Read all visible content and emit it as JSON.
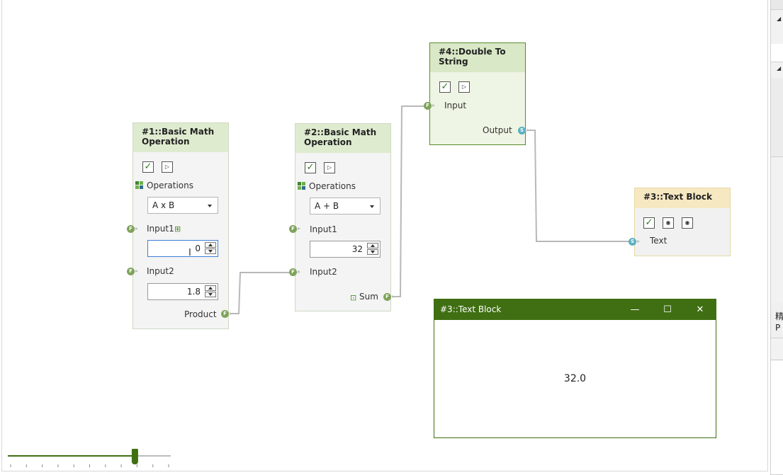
{
  "nodes": {
    "n1": {
      "title": "#1::Basic Math Operation",
      "operations_label": "Operations",
      "operation_value": "A x B",
      "input1_label": "Input1",
      "input1_value": "0",
      "input2_label": "Input2",
      "input2_value": "1.8",
      "output_label": "Product"
    },
    "n2": {
      "title": "#2::Basic Math Operation",
      "operations_label": "Operations",
      "operation_value": "A + B",
      "input1_label": "Input1",
      "input1_value": "32",
      "input2_label": "Input2",
      "output_label": "Sum"
    },
    "n4": {
      "title": "#4::Double To String",
      "input_label": "Input",
      "output_label": "Output"
    },
    "n3": {
      "title": "#3::Text Block",
      "input_label": "Text"
    }
  },
  "text_window": {
    "title": "#3::Text Block",
    "content": "32.0",
    "minimize": "—",
    "maximize": "☐",
    "close": "✕"
  },
  "right_pane": {
    "char1": "精",
    "char2": "P"
  },
  "ports": {
    "float": "F",
    "string": "S"
  },
  "zoom_slider": {
    "value_fraction": 0.78
  },
  "colors": {
    "accent": "#3f6f12",
    "node_header": "#dfebcf",
    "textblock_header": "#f6e8c1",
    "float_port": "#7ea35a",
    "string_port": "#5bb0c0"
  }
}
